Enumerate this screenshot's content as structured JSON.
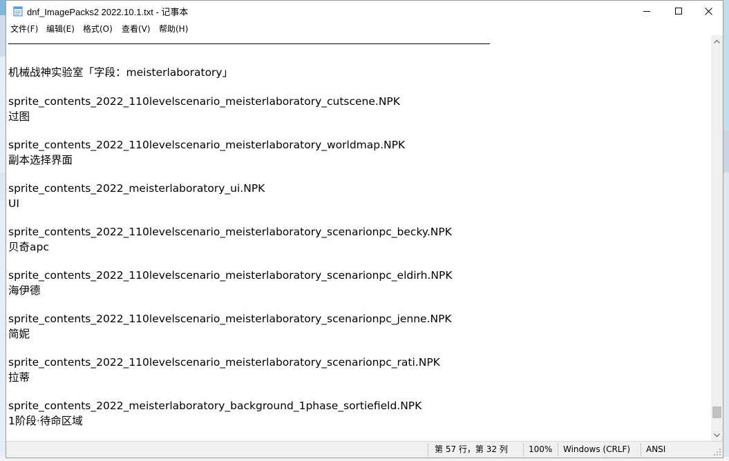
{
  "window": {
    "title": "dnf_ImagePacks2 2022.10.1.txt - 记事本"
  },
  "menu": {
    "items": [
      "文件(F)",
      "编辑(E)",
      "格式(O)",
      "查看(V)",
      "帮助(H)"
    ]
  },
  "document": {
    "lines": [
      "机械战神实验室「字段：meisterlaboratory」",
      "sprite_contents_2022_110levelscenario_meisterlaboratory_cutscene.NPK",
      "过图",
      "sprite_contents_2022_110levelscenario_meisterlaboratory_worldmap.NPK",
      "副本选择界面",
      "sprite_contents_2022_meisterlaboratory_ui.NPK",
      "UI",
      "sprite_contents_2022_110levelscenario_meisterlaboratory_scenarionpc_becky.NPK",
      "贝奇apc",
      "sprite_contents_2022_110levelscenario_meisterlaboratory_scenarionpc_eldirh.NPK",
      "海伊德",
      "sprite_contents_2022_110levelscenario_meisterlaboratory_scenarionpc_jenne.NPK",
      "简妮",
      "sprite_contents_2022_110levelscenario_meisterlaboratory_scenarionpc_rati.NPK",
      "拉蒂",
      "sprite_contents_2022_meisterlaboratory_background_1phase_sortiefield.NPK",
      "1阶段·待命区域"
    ]
  },
  "status": {
    "position": "第 57 行，第 32 列",
    "zoom": "100%",
    "line_ending": "Windows (CRLF)",
    "encoding": "ANSI"
  },
  "scrollbar": {
    "position_fraction": 0.95
  },
  "colors": {
    "accent": "#000000",
    "statusbar_bg": "#f0f0f0",
    "scroll_thumb": "#c1c1c1"
  }
}
